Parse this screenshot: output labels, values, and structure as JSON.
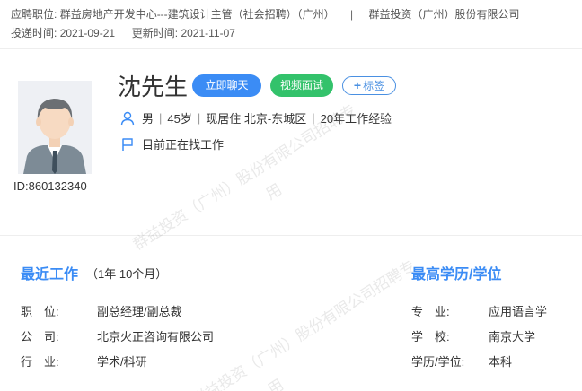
{
  "header": {
    "position_label": "应聘职位:",
    "position_value": "群益房地产开发中心---建筑设计主管（社会招聘）（广州）",
    "separator": "|",
    "company": "群益投资（广州）股份有限公司",
    "delivered_label": "投递时间:",
    "delivered_value": "2021-09-21",
    "updated_label": "更新时间:",
    "updated_value": "2021-11-07"
  },
  "profile": {
    "id_text": "ID:860132340",
    "name": "沈先生",
    "chat_button": "立即聊天",
    "video_button": "视频面试",
    "tag_button": "标签",
    "tag_plus": "+",
    "gender": "男",
    "age": "45岁",
    "location": "现居住 北京-东城区",
    "experience": "20年工作经验",
    "job_status": "目前正在找工作"
  },
  "recent_work": {
    "title": "最近工作",
    "duration": "（1年 10个月）",
    "position_label": "职　位:",
    "position_value": "副总经理/副总裁",
    "company_label": "公　司:",
    "company_value": "北京火正咨询有限公司",
    "industry_label": "行　业:",
    "industry_value": "学术/科研"
  },
  "education": {
    "title": "最高学历/学位",
    "major_label": "专　业:",
    "major_value": "应用语言学",
    "school_label": "学　校:",
    "school_value": "南京大学",
    "degree_label": "学历/学位:",
    "degree_value": "本科"
  },
  "watermark": {
    "line1": "群益投资（广州）股份有限公司招聘专",
    "line2": "用"
  },
  "colors": {
    "accent": "#3b8cf5",
    "video": "#33c26b",
    "icon": "#3b8cf5"
  },
  "icons": {
    "person": "person-icon",
    "flag": "flag-icon"
  }
}
